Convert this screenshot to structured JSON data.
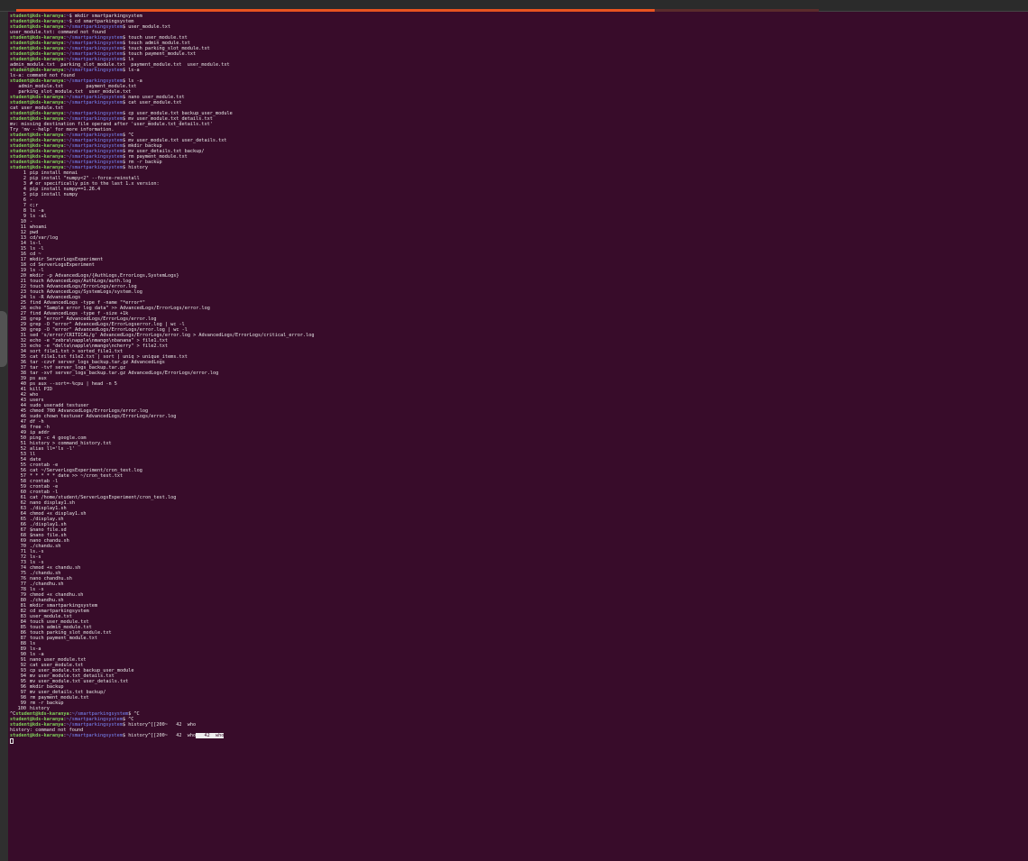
{
  "window": {
    "progress_fraction": 0.795
  },
  "prompt": {
    "user": "student@kds-karanya",
    "path_home": "~",
    "path_proj": "~/smartparkingsystem"
  },
  "lines": [
    {
      "t": "cmd",
      "d": "home",
      "c": "mkdir smartparkingsystem"
    },
    {
      "t": "cmd",
      "d": "home",
      "c": "cd smartparkingsystem"
    },
    {
      "t": "cmd",
      "d": "proj",
      "c": "user_module.txt"
    },
    {
      "t": "out",
      "c": "user_module.txt: command not found"
    },
    {
      "t": "cmd",
      "d": "proj",
      "c": "touch user_module.txt"
    },
    {
      "t": "cmd",
      "d": "proj",
      "c": "touch admin_module.txt"
    },
    {
      "t": "cmd",
      "d": "proj",
      "c": "touch parking_slot_module.txt"
    },
    {
      "t": "cmd",
      "d": "proj",
      "c": "touch payment_module.txt"
    },
    {
      "t": "cmd",
      "d": "proj",
      "c": "ls"
    },
    {
      "t": "out",
      "c": "admin_module.txt  parking_slot_module.txt  payment_module.txt  user_module.txt"
    },
    {
      "t": "cmd",
      "d": "proj",
      "c": "ls-a"
    },
    {
      "t": "out",
      "c": "ls-a: command not found"
    },
    {
      "t": "cmd",
      "d": "proj",
      "c": "ls -a"
    },
    {
      "t": "out",
      "c": "   admin_module.txt        payment_module.txt"
    },
    {
      "t": "out",
      "c": "   parking_slot_module.txt  user_module.txt"
    },
    {
      "t": "cmd",
      "d": "proj",
      "c": "nano user_module.txt"
    },
    {
      "t": "cmd",
      "d": "proj",
      "c": "cat user_module.txt"
    },
    {
      "t": "out",
      "c": "cat user_module.txt"
    },
    {
      "t": "cmd",
      "d": "proj",
      "c": "cp user_module.txt backup_user_module"
    },
    {
      "t": "cmd",
      "d": "proj",
      "c": "mv user_module.txt_details.txt"
    },
    {
      "t": "out",
      "c": "mv: missing destination file operand after 'user_module.txt_details.txt'"
    },
    {
      "t": "out",
      "c": "Try 'mv --help' for more information."
    },
    {
      "t": "cmd",
      "d": "proj",
      "c": "^C"
    },
    {
      "t": "cmd",
      "d": "proj",
      "c": "mv user_module.txt user_details.txt"
    },
    {
      "t": "cmd",
      "d": "proj",
      "c": "mkdir backup"
    },
    {
      "t": "cmd",
      "d": "proj",
      "c": "mv user_details.txt backup/"
    },
    {
      "t": "cmd",
      "d": "proj",
      "c": "rm payment_module.txt"
    },
    {
      "t": "cmd",
      "d": "proj",
      "c": "rm -r backup"
    },
    {
      "t": "cmd",
      "d": "proj",
      "c": "history"
    },
    {
      "t": "h",
      "n": "1",
      "c": "pip install monai"
    },
    {
      "t": "h",
      "n": "2",
      "c": "pip install \"numpy<2\" --force-reinstall"
    },
    {
      "t": "h",
      "n": "3",
      "c": "# or specifically pin to the last 1.x version:"
    },
    {
      "t": "h",
      "n": "4",
      "c": "pip install numpy==1.26.4"
    },
    {
      "t": "h",
      "n": "5",
      "c": "pip install numpy"
    },
    {
      "t": "h",
      "n": "6",
      "c": "-"
    },
    {
      "t": "h",
      "n": "7",
      "c": "c;r"
    },
    {
      "t": "h",
      "n": "8",
      "c": "ls -a"
    },
    {
      "t": "h",
      "n": "9",
      "c": "ls -al"
    },
    {
      "t": "h",
      "n": "10",
      "c": "-"
    },
    {
      "t": "h",
      "n": "11",
      "c": "whoami"
    },
    {
      "t": "h",
      "n": "12",
      "c": "pwd"
    },
    {
      "t": "h",
      "n": "13",
      "c": "cd/var/log"
    },
    {
      "t": "h",
      "n": "14",
      "c": "ls-l"
    },
    {
      "t": "h",
      "n": "15",
      "c": "ls -l"
    },
    {
      "t": "h",
      "n": "16",
      "c": "cd ~"
    },
    {
      "t": "h",
      "n": "17",
      "c": "mkdir ServerLogsExperiment"
    },
    {
      "t": "h",
      "n": "18",
      "c": "cd ServerLogsExperiment"
    },
    {
      "t": "h",
      "n": "19",
      "c": "ls -l"
    },
    {
      "t": "h",
      "n": "20",
      "c": "mkdir -p AdvancedLogs/{AuthLogs,ErrorLogs,SystemLogs}"
    },
    {
      "t": "h",
      "n": "21",
      "c": "touch AdvancedLogs/AuthLogs/auth.log"
    },
    {
      "t": "h",
      "n": "22",
      "c": "touch AdvancedLogs/ErrorLogs/error.log"
    },
    {
      "t": "h",
      "n": "23",
      "c": "touch AdvancedLogs/SystemLogs/system.log"
    },
    {
      "t": "h",
      "n": "24",
      "c": "ls -R AdvancedLogs"
    },
    {
      "t": "h",
      "n": "25",
      "c": "find AdvancedLogs -type f -name \"*error*\""
    },
    {
      "t": "h",
      "n": "26",
      "c": "echo \"Sample error log data\" >> AdvancedLogs/ErrorLogs/error.log"
    },
    {
      "t": "h",
      "n": "27",
      "c": "find AdvancedLogs -type f -size +1k"
    },
    {
      "t": "h",
      "n": "28",
      "c": "grep \"error\" AdvancedLogs/ErrorLogs/error.log"
    },
    {
      "t": "h",
      "n": "29",
      "c": "grep -O \"error\" AdvancedLogs/ErrorLogserror.log | wc -l"
    },
    {
      "t": "h",
      "n": "30",
      "c": "grep -O \"error\" AdvancedLogs/ErrorLogs/error.log | wc -l"
    },
    {
      "t": "h",
      "n": "31",
      "c": "sed 's/error/CRITICAL/g' AdvancedLogs/ErrorLogs/error.log > AdvancedLogs/ErrorLogs/critical_error.log"
    },
    {
      "t": "h",
      "n": "32",
      "c": "echo -e \"zebra\\napple\\nmango\\nbanana\" > file1.txt"
    },
    {
      "t": "h",
      "n": "33",
      "c": "echo -e \"delta\\napple\\nmango\\ncherry\" > file2.txt"
    },
    {
      "t": "h",
      "n": "34",
      "c": "sort file1.txt > sorted_file1.txt"
    },
    {
      "t": "h",
      "n": "35",
      "c": "cat file1.txt file2.txt | sort | uniq > unique_items.txt"
    },
    {
      "t": "h",
      "n": "36",
      "c": "tar -czvf server_logs_backup.tar.gz AdvancedLogs"
    },
    {
      "t": "h",
      "n": "37",
      "c": "tar -tvf server_logs_backup.tar.gz"
    },
    {
      "t": "h",
      "n": "38",
      "c": "tar -xvf server_logs_backup.tar.gz AdvancedLogs/ErrorLogs/error.log"
    },
    {
      "t": "h",
      "n": "39",
      "c": "ps aux"
    },
    {
      "t": "h",
      "n": "40",
      "c": "ps aux --sort=-%cpu | head -n 5"
    },
    {
      "t": "h",
      "n": "41",
      "c": "kill PID"
    },
    {
      "t": "h",
      "n": "42",
      "c": "who"
    },
    {
      "t": "h",
      "n": "43",
      "c": "users"
    },
    {
      "t": "h",
      "n": "44",
      "c": "sudo useradd testuser"
    },
    {
      "t": "h",
      "n": "45",
      "c": "chmod 700 AdvancedLogs/ErrorLogs/error.log"
    },
    {
      "t": "h",
      "n": "46",
      "c": "sudo chown testuser AdvancedLogs/ErrorLogs/error.log"
    },
    {
      "t": "h",
      "n": "47",
      "c": "df -h"
    },
    {
      "t": "h",
      "n": "48",
      "c": "free -h"
    },
    {
      "t": "h",
      "n": "49",
      "c": "ip addr"
    },
    {
      "t": "h",
      "n": "50",
      "c": "ping -c 4 google.com"
    },
    {
      "t": "h",
      "n": "51",
      "c": "history > command_history.txt"
    },
    {
      "t": "h",
      "n": "52",
      "c": "alias ll='ls -l'"
    },
    {
      "t": "h",
      "n": "53",
      "c": "ll"
    },
    {
      "t": "h",
      "n": "54",
      "c": "date"
    },
    {
      "t": "h",
      "n": "55",
      "c": "crontab -e"
    },
    {
      "t": "h",
      "n": "56",
      "c": "cat ~/ServerLogsExperiment/cron_test.log"
    },
    {
      "t": "h",
      "n": "57",
      "c": "* * * * * date >> ~/cron_test.txt"
    },
    {
      "t": "h",
      "n": "58",
      "c": "crontab -l"
    },
    {
      "t": "h",
      "n": "59",
      "c": "crontab -e"
    },
    {
      "t": "h",
      "n": "60",
      "c": "crontab -l"
    },
    {
      "t": "h",
      "n": "61",
      "c": "cat /home/student/ServerLogsExperiment/cron_test.log"
    },
    {
      "t": "h",
      "n": "62",
      "c": "nano display1.sh"
    },
    {
      "t": "h",
      "n": "63",
      "c": "./display1.sh"
    },
    {
      "t": "h",
      "n": "64",
      "c": "chmod +x display1.sh"
    },
    {
      "t": "h",
      "n": "65",
      "c": "./display.sh"
    },
    {
      "t": "h",
      "n": "66",
      "c": "./display1.sh"
    },
    {
      "t": "h",
      "n": "67",
      "c": "$nano file.sd"
    },
    {
      "t": "h",
      "n": "68",
      "c": "$nano file.sh"
    },
    {
      "t": "h",
      "n": "69",
      "c": "nano chandu.sh"
    },
    {
      "t": "h",
      "n": "70",
      "c": "./chandu.sh"
    },
    {
      "t": "h",
      "n": "71",
      "c": "ls.-s"
    },
    {
      "t": "h",
      "n": "72",
      "c": "ls-s"
    },
    {
      "t": "h",
      "n": "73",
      "c": "ls -s"
    },
    {
      "t": "h",
      "n": "74",
      "c": "chmod +x chandu.sh"
    },
    {
      "t": "h",
      "n": "75",
      "c": "./chandu.sh"
    },
    {
      "t": "h",
      "n": "76",
      "c": "nano chandhu.sh"
    },
    {
      "t": "h",
      "n": "77",
      "c": "./chandhu.sh"
    },
    {
      "t": "h",
      "n": "78",
      "c": "ls -s"
    },
    {
      "t": "h",
      "n": "79",
      "c": "chmod +x chandhu.sh"
    },
    {
      "t": "h",
      "n": "80",
      "c": "./chandhu.sh"
    },
    {
      "t": "h",
      "n": "81",
      "c": "mkdir smartparkingsystem"
    },
    {
      "t": "h",
      "n": "82",
      "c": "cd smartparkingsystem"
    },
    {
      "t": "h",
      "n": "83",
      "c": "user_module.txt"
    },
    {
      "t": "h",
      "n": "84",
      "c": "touch user_module.txt"
    },
    {
      "t": "h",
      "n": "85",
      "c": "touch admin_module.txt"
    },
    {
      "t": "h",
      "n": "86",
      "c": "touch parking_slot_module.txt"
    },
    {
      "t": "h",
      "n": "87",
      "c": "touch payment_module.txt"
    },
    {
      "t": "h",
      "n": "88",
      "c": "ls"
    },
    {
      "t": "h",
      "n": "89",
      "c": "ls-a"
    },
    {
      "t": "h",
      "n": "90",
      "c": "ls -a"
    },
    {
      "t": "h",
      "n": "91",
      "c": "nano user_module.txt"
    },
    {
      "t": "h",
      "n": "92",
      "c": "cat user_module.txt"
    },
    {
      "t": "h",
      "n": "93",
      "c": "cp user_module.txt backup_user_module"
    },
    {
      "t": "h",
      "n": "94",
      "c": "mv user_module.txt_details.txt"
    },
    {
      "t": "h",
      "n": "95",
      "c": "mv user_module.txt user_details.txt"
    },
    {
      "t": "h",
      "n": "96",
      "c": "mkdir backup"
    },
    {
      "t": "h",
      "n": "97",
      "c": "mv user_details.txt backup/"
    },
    {
      "t": "h",
      "n": "98",
      "c": "rm payment_module.txt"
    },
    {
      "t": "h",
      "n": "99",
      "c": "rm -r backup"
    },
    {
      "t": "h",
      "n": "100",
      "c": "history"
    },
    {
      "t": "cmd",
      "d": "proj",
      "pre": "^C",
      "c": "^C"
    },
    {
      "t": "cmd",
      "d": "proj",
      "c": "^C"
    },
    {
      "t": "cmd",
      "d": "proj",
      "c": "history^[[200~   42  who"
    },
    {
      "t": "out",
      "c": "history: command not found"
    },
    {
      "t": "cmd",
      "d": "proj",
      "c": "history^[[200~   42  who",
      "sel": "   42  who"
    },
    {
      "t": "cur"
    }
  ]
}
